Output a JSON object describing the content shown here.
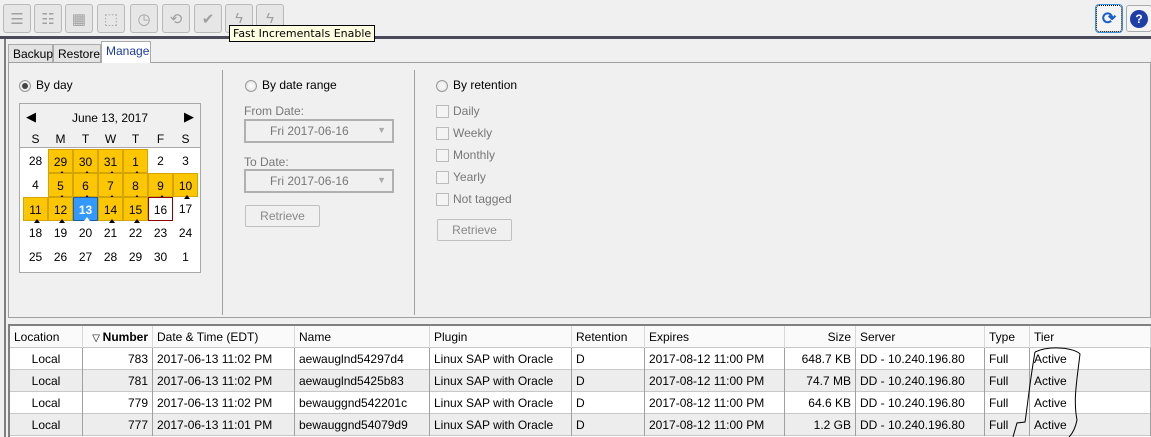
{
  "toolbar": {
    "buttons": [
      "search-list-icon",
      "search-detail-icon",
      "select-icon",
      "select-dashed-icon",
      "schedule-icon",
      "restore-icon",
      "verify-icon",
      "fast-incremental-enable-icon",
      "fast-incremental-disable-icon"
    ],
    "tooltip": "Fast Incrementals Enable",
    "refresh": "refresh-icon",
    "help": "help-icon"
  },
  "tabs": [
    "Backup",
    "Restore",
    "Manage"
  ],
  "active_tab": "Manage",
  "by_day": {
    "label": "By day",
    "calendar": {
      "title": "June 13, 2017",
      "weekdays": [
        "S",
        "M",
        "T",
        "W",
        "T",
        "F",
        "S"
      ],
      "weeks": [
        [
          "28",
          "29",
          "30",
          "31",
          "1",
          "2",
          "3"
        ],
        [
          "4",
          "5",
          "6",
          "7",
          "8",
          "9",
          "10"
        ],
        [
          "11",
          "12",
          "13",
          "14",
          "15",
          "16",
          "17"
        ],
        [
          "18",
          "19",
          "20",
          "21",
          "22",
          "23",
          "24"
        ],
        [
          "25",
          "26",
          "27",
          "28",
          "29",
          "30",
          "1"
        ]
      ],
      "highlighted": [
        [
          0,
          1
        ],
        [
          0,
          2
        ],
        [
          0,
          3
        ],
        [
          0,
          4
        ],
        [
          1,
          1
        ],
        [
          1,
          2
        ],
        [
          1,
          3
        ],
        [
          1,
          4
        ],
        [
          1,
          5
        ],
        [
          1,
          6
        ],
        [
          2,
          0
        ],
        [
          2,
          1
        ],
        [
          2,
          3
        ],
        [
          2,
          4
        ]
      ],
      "selected": [
        2,
        2
      ],
      "today": [
        2,
        5
      ]
    }
  },
  "by_date_range": {
    "label": "By date range",
    "from_label": "From Date:",
    "from_value": "Fri 2017-06-16",
    "to_label": "To Date:",
    "to_value": "Fri 2017-06-16",
    "retrieve": "Retrieve"
  },
  "by_retention": {
    "label": "By retention",
    "options": [
      "Daily",
      "Weekly",
      "Monthly",
      "Yearly",
      "Not tagged"
    ],
    "retrieve": "Retrieve"
  },
  "table": {
    "columns": [
      "Location",
      "Number",
      "Date & Time (EDT)",
      "Name",
      "Plugin",
      "Retention",
      "Expires",
      "Size",
      "Server",
      "Type",
      "Tier"
    ],
    "rows": [
      [
        "Local",
        "783",
        "2017-06-13 11:02 PM",
        "aewauglnd54297d4",
        "Linux SAP with Oracle",
        "D",
        "2017-08-12 11:00 PM",
        "648.7 KB",
        "DD - 10.240.196.80",
        "Full",
        "Active"
      ],
      [
        "Local",
        "781",
        "2017-06-13 11:02 PM",
        "aewauglnd5425b83",
        "Linux SAP with Oracle",
        "D",
        "2017-08-12 11:00 PM",
        "74.7 MB",
        "DD - 10.240.196.80",
        "Full",
        "Active"
      ],
      [
        "Local",
        "779",
        "2017-06-13 11:02 PM",
        "bewauggnd542201c",
        "Linux SAP with Oracle",
        "D",
        "2017-08-12 11:00 PM",
        "64.6 KB",
        "DD - 10.240.196.80",
        "Full",
        "Active"
      ],
      [
        "Local",
        "777",
        "2017-06-13 11:01 PM",
        "bewauggnd54079d9",
        "Linux SAP with Oracle",
        "D",
        "2017-08-12 11:00 PM",
        "1.2 GB",
        "DD - 10.240.196.80",
        "Full",
        "Active"
      ]
    ]
  }
}
